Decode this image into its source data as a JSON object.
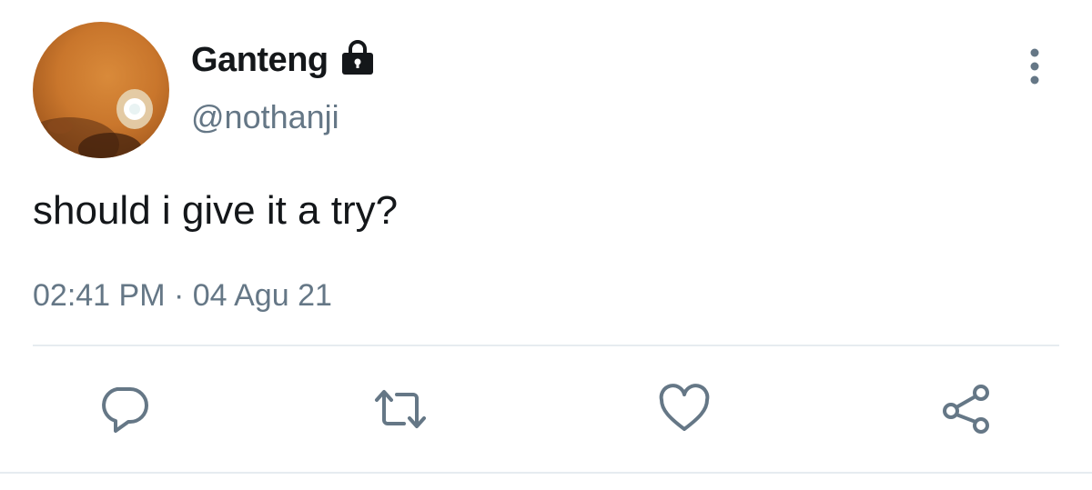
{
  "user": {
    "display_name": "Ganteng",
    "handle": "@nothanji",
    "protected_icon": "lock-icon",
    "avatar": "avatar-image"
  },
  "tweet": {
    "text": "should i give it a try?",
    "timestamp": "02:41 PM · 04 Agu 21"
  },
  "actions": [
    {
      "name": "reply",
      "icon": "reply-icon"
    },
    {
      "name": "retweet",
      "icon": "retweet-icon"
    },
    {
      "name": "like",
      "icon": "heart-icon"
    },
    {
      "name": "share",
      "icon": "share-icon"
    }
  ],
  "menu": {
    "icon": "more-vertical-icon"
  },
  "colors": {
    "text_primary": "#14171a",
    "text_secondary": "#657786",
    "divider": "#e6ecf0"
  }
}
